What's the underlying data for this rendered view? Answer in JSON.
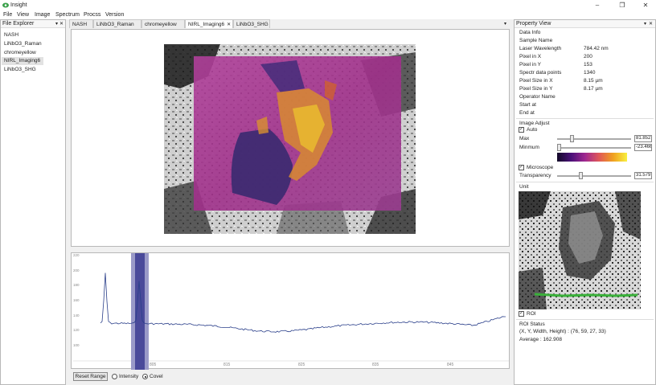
{
  "window": {
    "title": "Insight"
  },
  "menu": [
    "File",
    "View",
    "Image",
    "Spectrum",
    "Procss",
    "Version"
  ],
  "file_explorer": {
    "title": "File Explorer",
    "items": [
      "NASH",
      "LiNbO3_Raman",
      "chromeyellow",
      "NIRL_Imaging6",
      "LiNbO3_SHG"
    ],
    "selected": "NIRL_Imaging6"
  },
  "tabs": [
    "NASH",
    "LiNbO3_Raman",
    "chromeyellow",
    "NIRL_Imaging6",
    "LiNbO3_SHG"
  ],
  "active_tab": "NIRL_Imaging6",
  "property_view": {
    "title": "Property View",
    "data_info_title": "Data Info",
    "rows": [
      {
        "label": "Sample Name",
        "value": ""
      },
      {
        "label": "Laser Wavelength",
        "value": "784.42 nm"
      },
      {
        "label": "Pixel in X",
        "value": "200"
      },
      {
        "label": "Pixel in Y",
        "value": "153"
      },
      {
        "label": "Spectr data points",
        "value": "1340"
      },
      {
        "label": "Pixel Size in X",
        "value": "8.15 µm"
      },
      {
        "label": "Pixel Size in Y",
        "value": "8.17 µm"
      },
      {
        "label": "Operator Name",
        "value": ""
      },
      {
        "label": "Start at",
        "value": ""
      },
      {
        "label": "End at",
        "value": ""
      }
    ],
    "image_adjust": {
      "title": "Image Adjust",
      "auto_label": "Auto",
      "auto_checked": true,
      "max_label": "Max",
      "max_value": "81.852",
      "min_label": "Minmum",
      "min_value": "-23.466",
      "microscope_label": "Microscope",
      "microscope_checked": true,
      "transparency_label": "Transparency",
      "transparency_value": "31.579"
    },
    "unit_title": "Unit",
    "roi_label": "ROI",
    "roi_status_title": "ROI Status",
    "roi_coords": "(X, Y, Width, Height) : (76, 59, 27, 33)",
    "roi_average": "Average : 162.908"
  },
  "spectrum": {
    "x_ticks": [
      "805",
      "815",
      "825",
      "835",
      "845"
    ],
    "y_ticks": [
      "220",
      "200",
      "180",
      "160",
      "140",
      "120",
      "100"
    ],
    "reset_label": "Reset Range",
    "radio_intensity": "Intensity",
    "radio_covel": "Covel",
    "selected_radio": "Covel"
  },
  "colors": {
    "band_dark": "#4a4a9a",
    "band_light": "#9a9ac8",
    "line": "#2a3f8a",
    "roi_green": "#3ab03a"
  }
}
